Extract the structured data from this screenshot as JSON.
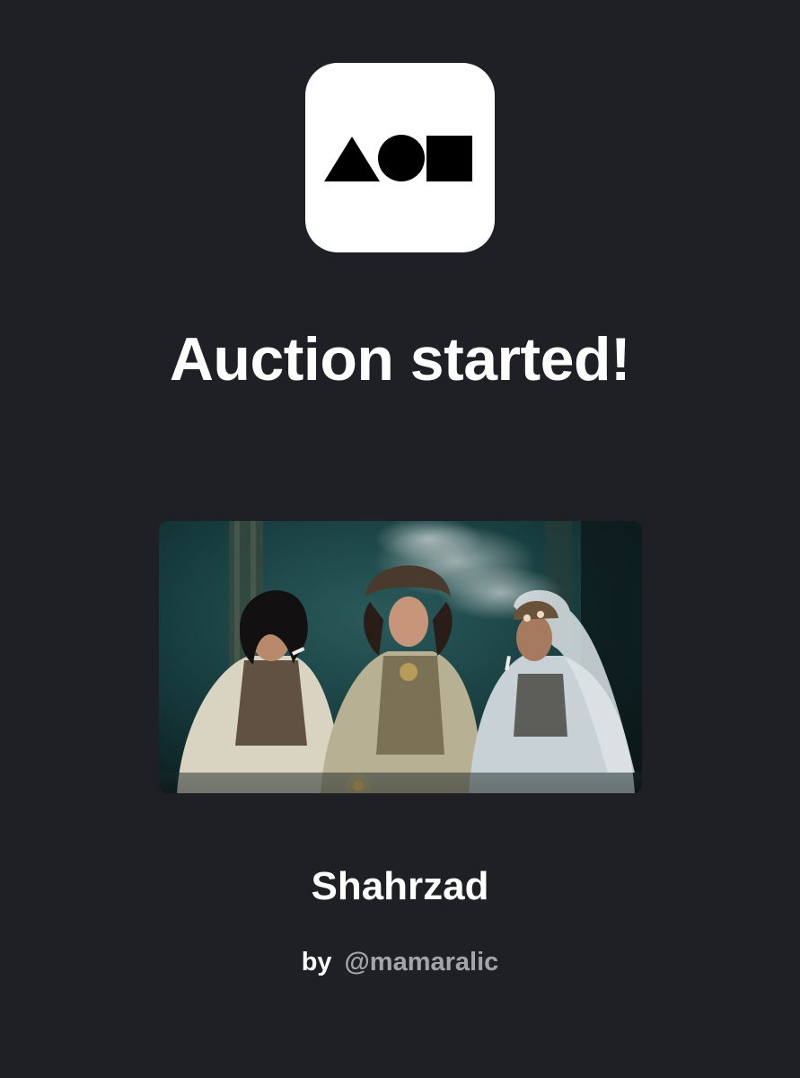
{
  "app": {
    "icon_name": "triangle-circle-square-logo-icon",
    "icon_background": "#ffffff",
    "icon_glyph_color": "#000000"
  },
  "notification": {
    "headline": "Auction started!"
  },
  "artwork": {
    "title": "Shahrzad",
    "by_label": "by",
    "artist_handle": "@mamaralic",
    "image_name": "artwork-image"
  },
  "colors": {
    "background": "#1f2025",
    "text_primary": "#ffffff",
    "text_secondary": "#a4a5aa"
  }
}
